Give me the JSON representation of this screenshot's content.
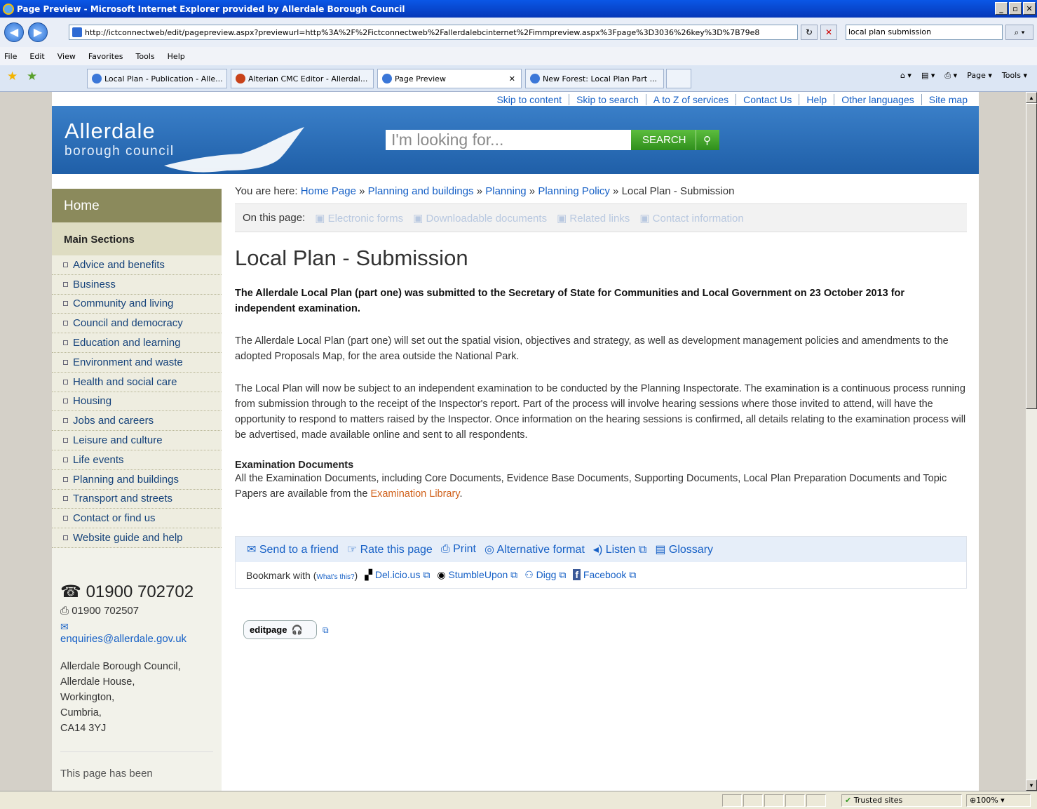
{
  "window": {
    "title": "Page Preview - Microsoft Internet Explorer provided by Allerdale Borough Council"
  },
  "browser": {
    "url": "http://ictconnectweb/edit/pagepreview.aspx?previewurl=http%3A%2F%2Fictconnectweb%2Fallerdalebcinternet%2Fimmpreview.aspx%3Fpage%3D3036%26key%3D%7B79e8",
    "search_value": "local plan submission",
    "menu": [
      "File",
      "Edit",
      "View",
      "Favorites",
      "Tools",
      "Help"
    ],
    "tabs": [
      "Local Plan - Publication - Alle...",
      "Alterian CMC Editor - Allerdal...",
      "Page Preview",
      "New Forest: Local Plan Part ..."
    ],
    "commands": [
      "Page ▾",
      "Tools ▾"
    ],
    "status": {
      "zone": "Trusted sites",
      "zoom": "100%"
    }
  },
  "site": {
    "toplinks": [
      "Skip to content",
      "Skip to search",
      "A to Z of services",
      "Contact Us",
      "Help",
      "Other languages",
      "Site map"
    ],
    "logo_line1": "Allerdale",
    "logo_line2": "borough council",
    "search_placeholder": "I'm looking for...",
    "search_button": "SEARCH"
  },
  "sidebar": {
    "home": "Home",
    "main_sections": "Main Sections",
    "items": [
      "Advice and benefits",
      "Business",
      "Community and living",
      "Council and democracy",
      "Education and learning",
      "Environment and waste",
      "Health and social care",
      "Housing",
      "Jobs and careers",
      "Leisure and culture",
      "Life events",
      "Planning and buildings",
      "Transport and streets",
      "Contact or find us",
      "Website guide and help"
    ],
    "phone": "01900 702702",
    "fax": "01900 702507",
    "email": "enquiries@allerdale.gov.uk",
    "address": [
      "Allerdale Borough Council,",
      "Allerdale House,",
      "Workington,",
      "Cumbria,",
      "CA14 3YJ"
    ],
    "footer_text": "This page has been"
  },
  "content": {
    "crumb_prefix": "You are here:",
    "crumbs": [
      "Home Page",
      "Planning and buildings",
      "Planning",
      "Planning Policy"
    ],
    "crumb_current": "Local Plan - Submission",
    "onpage_label": "On this page:",
    "onpage_items": [
      "Electronic forms",
      "Downloadable documents",
      "Related links",
      "Contact information"
    ],
    "title": "Local Plan - Submission",
    "lead": "The Allerdale Local Plan (part one) was submitted to the Secretary of State for Communities and Local Government on 23 October 2013 for independent examination",
    "p1": "The Allerdale Local Plan (part one) will set out the spatial vision, objectives and strategy, as well as development management policies and amendments to the adopted Proposals Map, for the area outside the National Park.",
    "p2": "The Local Plan will now be subject to an independent examination to be conducted by the Planning Inspectorate. The examination is a continuous process running from submission through to the receipt of the Inspector's report. Part of the process will involve hearing sessions where those invited to attend, will have the opportunity to respond to matters raised by the Inspector. Once information on the hearing sessions is confirmed, all details relating to the examination process will be advertised, made available online and sent to all respondents.",
    "exam_heading": "Examination Documents",
    "exam_text": "All the Examination Documents, including Core Documents, Evidence Base Documents, Supporting Documents, Local Plan Preparation Documents and Topic Papers are available from the",
    "exam_link": "Examination Library"
  },
  "tools": {
    "actions": [
      "Send to a friend",
      "Rate this page",
      "Print",
      "Alternative format",
      "Listen",
      "Glossary"
    ],
    "bookmark_label": "Bookmark with",
    "whats_this": "What's this?",
    "bookmarks": [
      "Del.icio.us",
      "StumbleUpon",
      "Digg",
      "Facebook"
    ],
    "edit_label": "editpage"
  }
}
